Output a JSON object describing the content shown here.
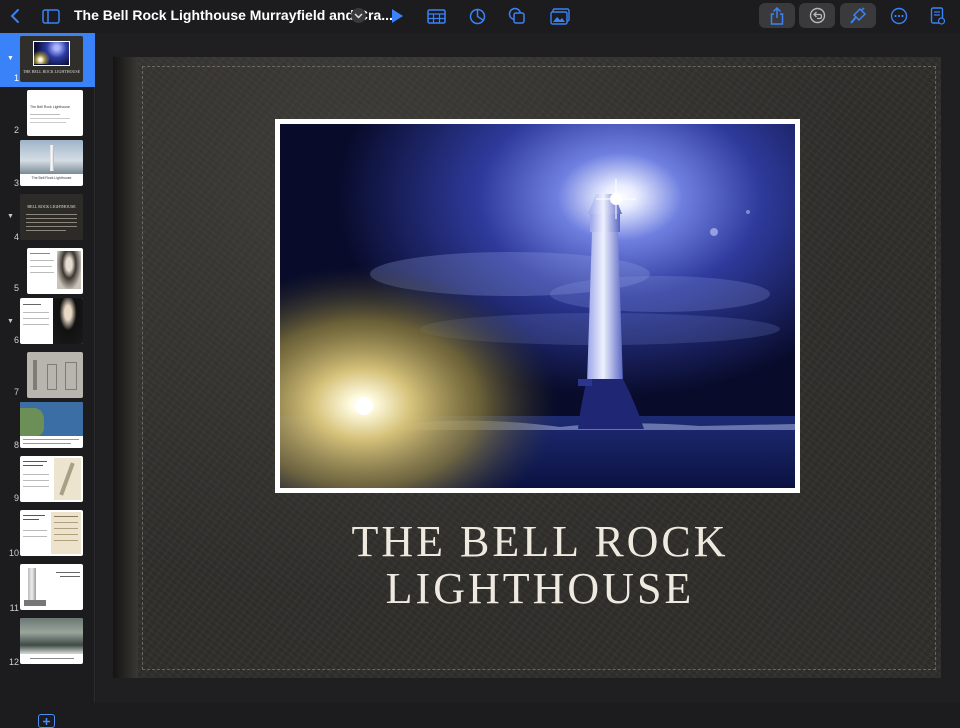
{
  "toolbar": {
    "document_title": "The Bell Rock Lighthouse Murrayfield and Cra...",
    "icons": [
      "chevron-left-icon",
      "sidebar-icon",
      "chevron-down-icon",
      "play-icon",
      "table-icon",
      "chart-icon",
      "shapes-icon",
      "media-icon",
      "share-icon",
      "undo-icon",
      "format-brush-icon",
      "more-icon",
      "document-icon"
    ]
  },
  "navigator": {
    "slides": [
      {
        "number": "1",
        "selected": true,
        "collapsible": true,
        "thumb_caption": "THE BELL ROCK LIGHTHOUSE"
      },
      {
        "number": "2",
        "selected": false,
        "collapsible": false,
        "thumb_caption": "The Bell Rock Lighthouse"
      },
      {
        "number": "3",
        "selected": false,
        "collapsible": false,
        "thumb_caption": "The Bell Rock Lighthouse"
      },
      {
        "number": "4",
        "selected": false,
        "collapsible": true,
        "thumb_caption": "BELL ROCK LIGHTHOUSE"
      },
      {
        "number": "5",
        "selected": false,
        "collapsible": false,
        "thumb_caption": ""
      },
      {
        "number": "6",
        "selected": false,
        "collapsible": true,
        "thumb_caption": ""
      },
      {
        "number": "7",
        "selected": false,
        "collapsible": false,
        "thumb_caption": ""
      },
      {
        "number": "8",
        "selected": false,
        "collapsible": false,
        "thumb_caption": ""
      },
      {
        "number": "9",
        "selected": false,
        "collapsible": false,
        "thumb_caption": ""
      },
      {
        "number": "10",
        "selected": false,
        "collapsible": false,
        "thumb_caption": ""
      },
      {
        "number": "11",
        "selected": false,
        "collapsible": false,
        "thumb_caption": ""
      },
      {
        "number": "12",
        "selected": false,
        "collapsible": false,
        "thumb_caption": ""
      }
    ]
  },
  "slide": {
    "title_line1": "THE BELL ROCK",
    "title_line2": "LIGHTHOUSE"
  },
  "colors": {
    "accent": "#3a82f7",
    "toolbar_bg": "#1c1c1e",
    "leather": "#2f2e2b",
    "title_text": "#efeae0"
  }
}
